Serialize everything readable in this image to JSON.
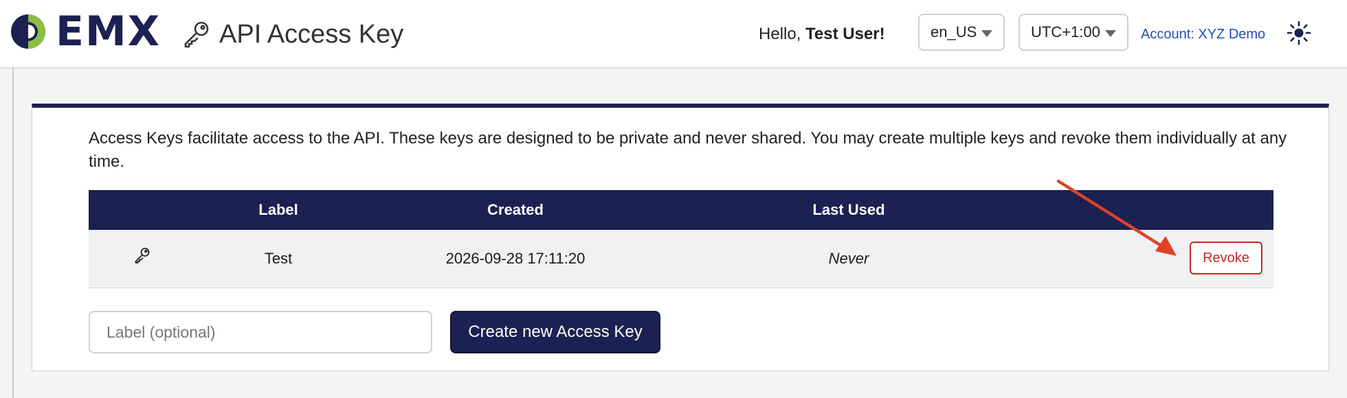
{
  "colors": {
    "brand_navy": "#1b2152",
    "brand_green": "#8cbf3f",
    "link_blue": "#1f4fb3",
    "danger_red": "#c62828",
    "annotation_red": "#e0402a"
  },
  "header": {
    "logo": {
      "icon": "emx-logo-mark",
      "text": "EMX"
    },
    "title_icon": "key-icon",
    "title": "API Access Key",
    "greeting_prefix": "Hello,",
    "user_name": "Test User!",
    "language": {
      "selected": "en_US"
    },
    "timezone": {
      "selected": "UTC+1:00"
    },
    "account_link": "Account: XYZ Demo",
    "theme_icon": "sun-icon"
  },
  "panel": {
    "intro": "Access Keys facilitate access to the API. These keys are designed to be private and never shared. You may create multiple keys and revoke them individually at any time.",
    "table": {
      "columns": [
        "",
        "Label",
        "Created",
        "Last Used",
        ""
      ],
      "rows": [
        {
          "icon": "key-icon",
          "label": "Test",
          "created": "2026-09-28 17:11:20",
          "last_used": "Never",
          "action": "Revoke"
        }
      ]
    },
    "form": {
      "label_placeholder": "Label (optional)",
      "label_value": "",
      "create_button": "Create new Access Key"
    }
  },
  "annotation": {
    "type": "arrow",
    "target": "revoke-button"
  }
}
